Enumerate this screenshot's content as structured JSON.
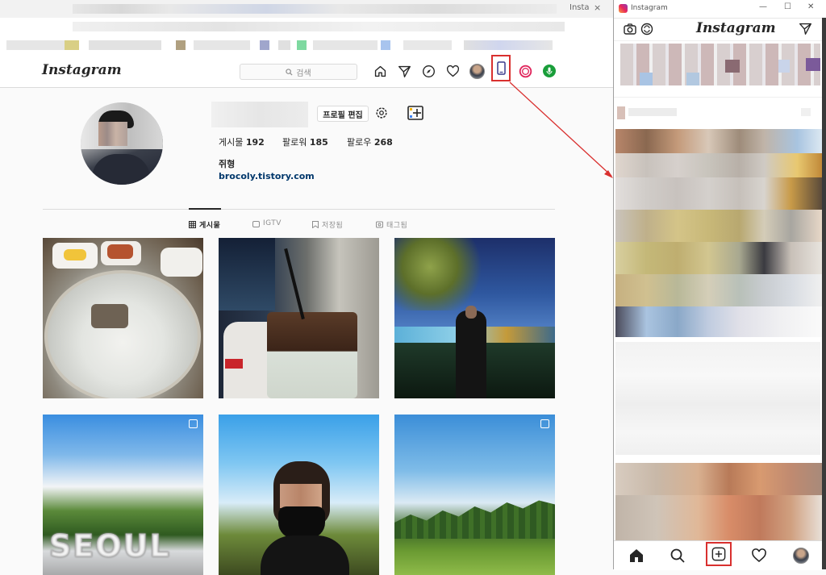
{
  "browser": {
    "tab_fragment_1": "Insta",
    "tab_close": "×",
    "window_title": "Instagram",
    "window_controls": [
      "—",
      "☐",
      "✕"
    ]
  },
  "web": {
    "logo": "Instagram",
    "search_placeholder": "검색",
    "nav_icons": [
      "home-icon",
      "direct-icon",
      "explore-icon",
      "activity-heart-icon",
      "profile-avatar",
      "mobile-view-icon",
      "stories-ring-icon",
      "mic-extension-icon"
    ],
    "profile": {
      "edit_button": "프로필 편집",
      "posts_label": "게시물",
      "posts_count": "192",
      "followers_label": "팔로워",
      "followers_count": "185",
      "following_label": "팔로우",
      "following_count": "268",
      "name": "쥐형",
      "website": "brocoly.tistory.com"
    },
    "tabs": [
      {
        "label": "게시물",
        "icon": "grid-icon"
      },
      {
        "label": "IGTV",
        "icon": "igtv-icon"
      },
      {
        "label": "저장됨",
        "icon": "bookmark-icon"
      },
      {
        "label": "태그됨",
        "icon": "tag-icon"
      }
    ],
    "posts": [
      "noodle-soup-photo",
      "iced-coffee-photo",
      "night-river-photo",
      "seoul-sign-photo",
      "selfie-mask-photo",
      "forest-sky-photo"
    ]
  },
  "mobile": {
    "logo": "Instagram",
    "bottom_nav": [
      "home-icon",
      "search-icon",
      "new-post-icon",
      "heart-icon",
      "profile-avatar"
    ]
  },
  "colors": {
    "annotation_red": "#d9302f",
    "link_blue": "#00376b",
    "border": "#dbdbdb"
  }
}
